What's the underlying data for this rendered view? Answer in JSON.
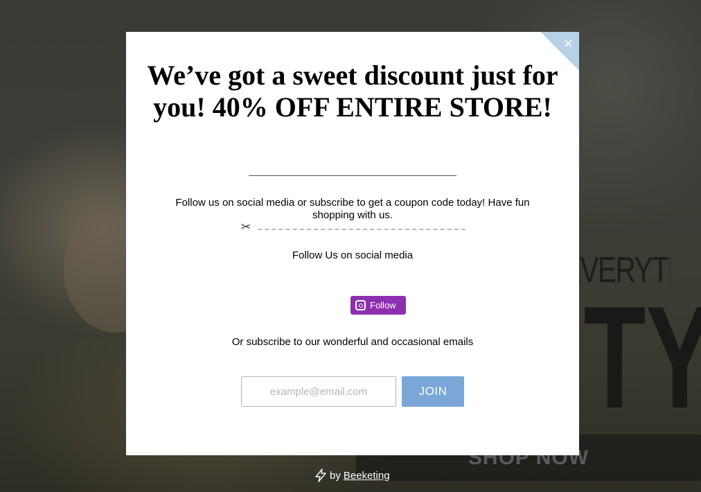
{
  "background": {
    "tagline_fragment": "EVERYTHING",
    "big_word_fragment": "TY",
    "shop_button": "SHOP NOW"
  },
  "popup": {
    "close_symbol": "×",
    "headline": "We’ve got a sweet discount just for you! 40% OFF ENTIRE STORE!",
    "intro": "Follow us on social media or subscribe to get a coupon code today! Have fun shopping with us.",
    "social_label": "Follow Us on social media",
    "follow_button": "Follow",
    "subscribe_label": "Or subscribe to our wonderful and occasional emails",
    "email_placeholder": "example@email.com",
    "email_value": "",
    "join_button": "JOIN",
    "colors": {
      "join": "#7aa7d8",
      "follow": "#8d2fb0",
      "close_corner": "#b7d2e6"
    }
  },
  "credit": {
    "by": "by",
    "brand": "Beeketing",
    "icon": "lightning-bolt-icon"
  }
}
